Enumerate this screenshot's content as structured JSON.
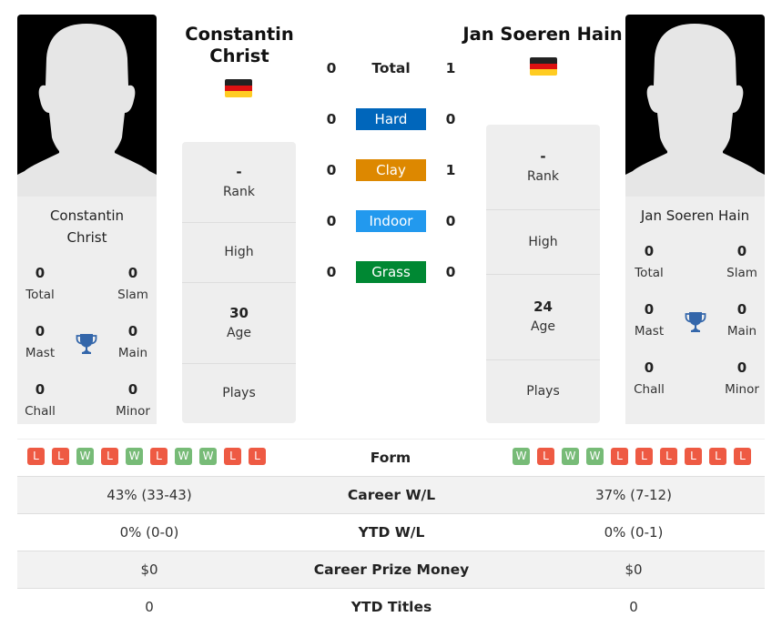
{
  "colors": {
    "hard": "#0066bb",
    "clay": "#dd8800",
    "indoor": "#2299ee",
    "grass": "#008833",
    "win": "#77bb77",
    "loss": "#ee5a43",
    "trophy": "#3366aa",
    "flag_black": "#222222",
    "flag_red": "#dd1111",
    "flag_gold": "#ffcc22"
  },
  "player1": {
    "name": "Constantin Christ",
    "card_name_line1": "Constantin",
    "card_name_line2": "Christ",
    "header_name_line1": "Constantin",
    "header_name_line2": "Christ",
    "flag": "Germany",
    "titles": {
      "total": {
        "value": "0",
        "label": "Total"
      },
      "slam": {
        "value": "0",
        "label": "Slam"
      },
      "mast": {
        "value": "0",
        "label": "Mast"
      },
      "main": {
        "value": "0",
        "label": "Main"
      },
      "chall": {
        "value": "0",
        "label": "Chall"
      },
      "minor": {
        "value": "0",
        "label": "Minor"
      }
    },
    "info": {
      "rank": {
        "value": "-",
        "label": "Rank"
      },
      "high": {
        "value": "",
        "label": "High"
      },
      "age": {
        "value": "30",
        "label": "Age"
      },
      "plays": {
        "value": "",
        "label": "Plays"
      }
    },
    "form": [
      "L",
      "L",
      "W",
      "L",
      "W",
      "L",
      "W",
      "W",
      "L",
      "L"
    ]
  },
  "player2": {
    "name": "Jan Soeren Hain",
    "card_name_line1": "Jan Soeren Hain",
    "header_name_line1": "Jan Soeren Hain",
    "flag": "Germany",
    "titles": {
      "total": {
        "value": "0",
        "label": "Total"
      },
      "slam": {
        "value": "0",
        "label": "Slam"
      },
      "mast": {
        "value": "0",
        "label": "Mast"
      },
      "main": {
        "value": "0",
        "label": "Main"
      },
      "chall": {
        "value": "0",
        "label": "Chall"
      },
      "minor": {
        "value": "0",
        "label": "Minor"
      }
    },
    "info": {
      "rank": {
        "value": "-",
        "label": "Rank"
      },
      "high": {
        "value": "",
        "label": "High"
      },
      "age": {
        "value": "24",
        "label": "Age"
      },
      "plays": {
        "value": "",
        "label": "Plays"
      }
    },
    "form": [
      "W",
      "L",
      "W",
      "W",
      "L",
      "L",
      "L",
      "L",
      "L",
      "L"
    ]
  },
  "surfaces": [
    {
      "label": "Total",
      "p1": "0",
      "p2": "1"
    },
    {
      "label": "Hard",
      "p1": "0",
      "p2": "0"
    },
    {
      "label": "Clay",
      "p1": "0",
      "p2": "1"
    },
    {
      "label": "Indoor",
      "p1": "0",
      "p2": "0"
    },
    {
      "label": "Grass",
      "p1": "0",
      "p2": "0"
    }
  ],
  "comparison": {
    "form_label": "Form",
    "rows": [
      {
        "label": "Career W/L",
        "p1": "43% (33-43)",
        "p2": "37% (7-12)"
      },
      {
        "label": "YTD W/L",
        "p1": "0% (0-0)",
        "p2": "0% (0-1)"
      },
      {
        "label": "Career Prize Money",
        "p1": "$0",
        "p2": "$0"
      },
      {
        "label": "YTD Titles",
        "p1": "0",
        "p2": "0"
      }
    ]
  }
}
